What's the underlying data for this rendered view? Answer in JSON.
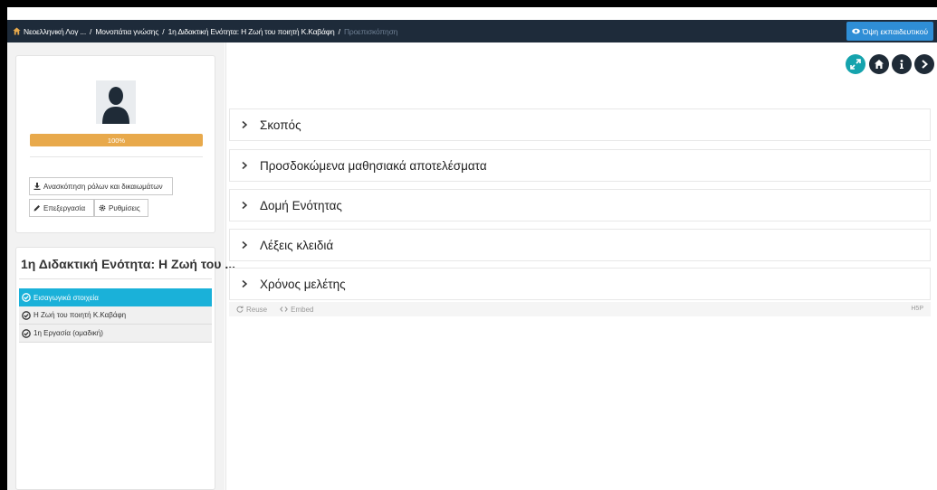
{
  "breadcrumb": {
    "items": [
      "Νεοελληνική Λογ ...",
      "Μονοπάτια γνώσης",
      "1η Διδακτική Ενότητα: Η Ζωή του ποιητή Κ.Καβάφη"
    ],
    "current": "Προεπισκόπηση"
  },
  "header": {
    "teacher_view_label": "Όψη εκπαιδευτικού"
  },
  "profile": {
    "progress_label": "100%",
    "progress_value": 100,
    "roles_button": "Ανασκόπηση ρόλων και δικαιωμάτων",
    "edit_button": "Επεξεργασία",
    "settings_button": "Ρυθμίσεις"
  },
  "unit": {
    "title": "1η Διδακτική Ενότητα: Η Ζωή του ...",
    "items": [
      {
        "label": "Εισαγωγικά στοιχεία",
        "active": true
      },
      {
        "label": "Η Ζωή του ποιητή Κ.Καβάφη",
        "active": false
      },
      {
        "label": "1η Εργασία (ομαδική)",
        "active": false
      }
    ]
  },
  "accordion": {
    "items": [
      "Σκοπός",
      "Προσδοκώμενα μαθησιακά αποτελέσματα",
      "Δομή Ενότητας",
      "Λέξεις κλειδιά",
      "Χρόνος μελέτης"
    ]
  },
  "footer": {
    "reuse_label": "Reuse",
    "embed_label": "Embed",
    "h5p_label": "H5P"
  },
  "colors": {
    "topbar": "#1e2b3a",
    "teacher_button": "#2f8ed6",
    "progress": "#e8a94b",
    "active_item": "#1ab1d9",
    "expand_button": "#15a3ad",
    "round_button": "#1f2b37"
  },
  "icons": [
    "home-icon",
    "eye-icon",
    "expand-icon",
    "house-icon",
    "info-icon",
    "next-icon",
    "download-icon",
    "pencil-icon",
    "gear-icon",
    "check-circle-icon",
    "chevron-right-icon",
    "reuse-icon",
    "embed-icon"
  ]
}
